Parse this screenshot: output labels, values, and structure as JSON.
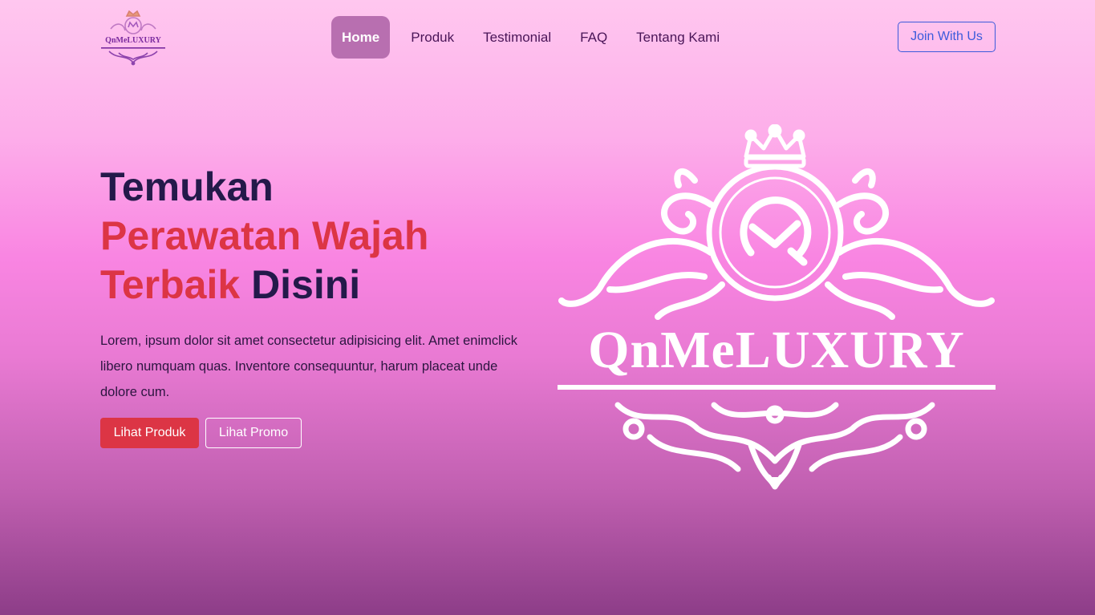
{
  "brand": {
    "name": "QnMeLUXURY",
    "colors": {
      "primary": "#dc3545",
      "dark": "#24194a",
      "nav_active": "#b86fb0",
      "join_border": "#3b5bdb"
    }
  },
  "nav": {
    "items": [
      {
        "label": "Home",
        "active": true
      },
      {
        "label": "Produk"
      },
      {
        "label": "Testimonial"
      },
      {
        "label": "FAQ"
      },
      {
        "label": "Tentang Kami"
      }
    ],
    "cta": "Join With Us"
  },
  "hero": {
    "title": {
      "part1": "Temukan",
      "part2": "Perawatan Wajah",
      "part3": "Terbaik",
      "part4": "Disini"
    },
    "description": "Lorem, ipsum dolor sit amet consectetur adipisicing elit. Amet enimclick libero numquam quas. Inventore consequuntur, harum placeat unde dolore cum.",
    "buttons": {
      "primary": "Lihat Produk",
      "secondary": "Lihat Promo"
    },
    "logo_text": "QnMeLUXURY"
  },
  "icons": [
    "crown-icon",
    "monogram-icon",
    "ornament-icon"
  ]
}
